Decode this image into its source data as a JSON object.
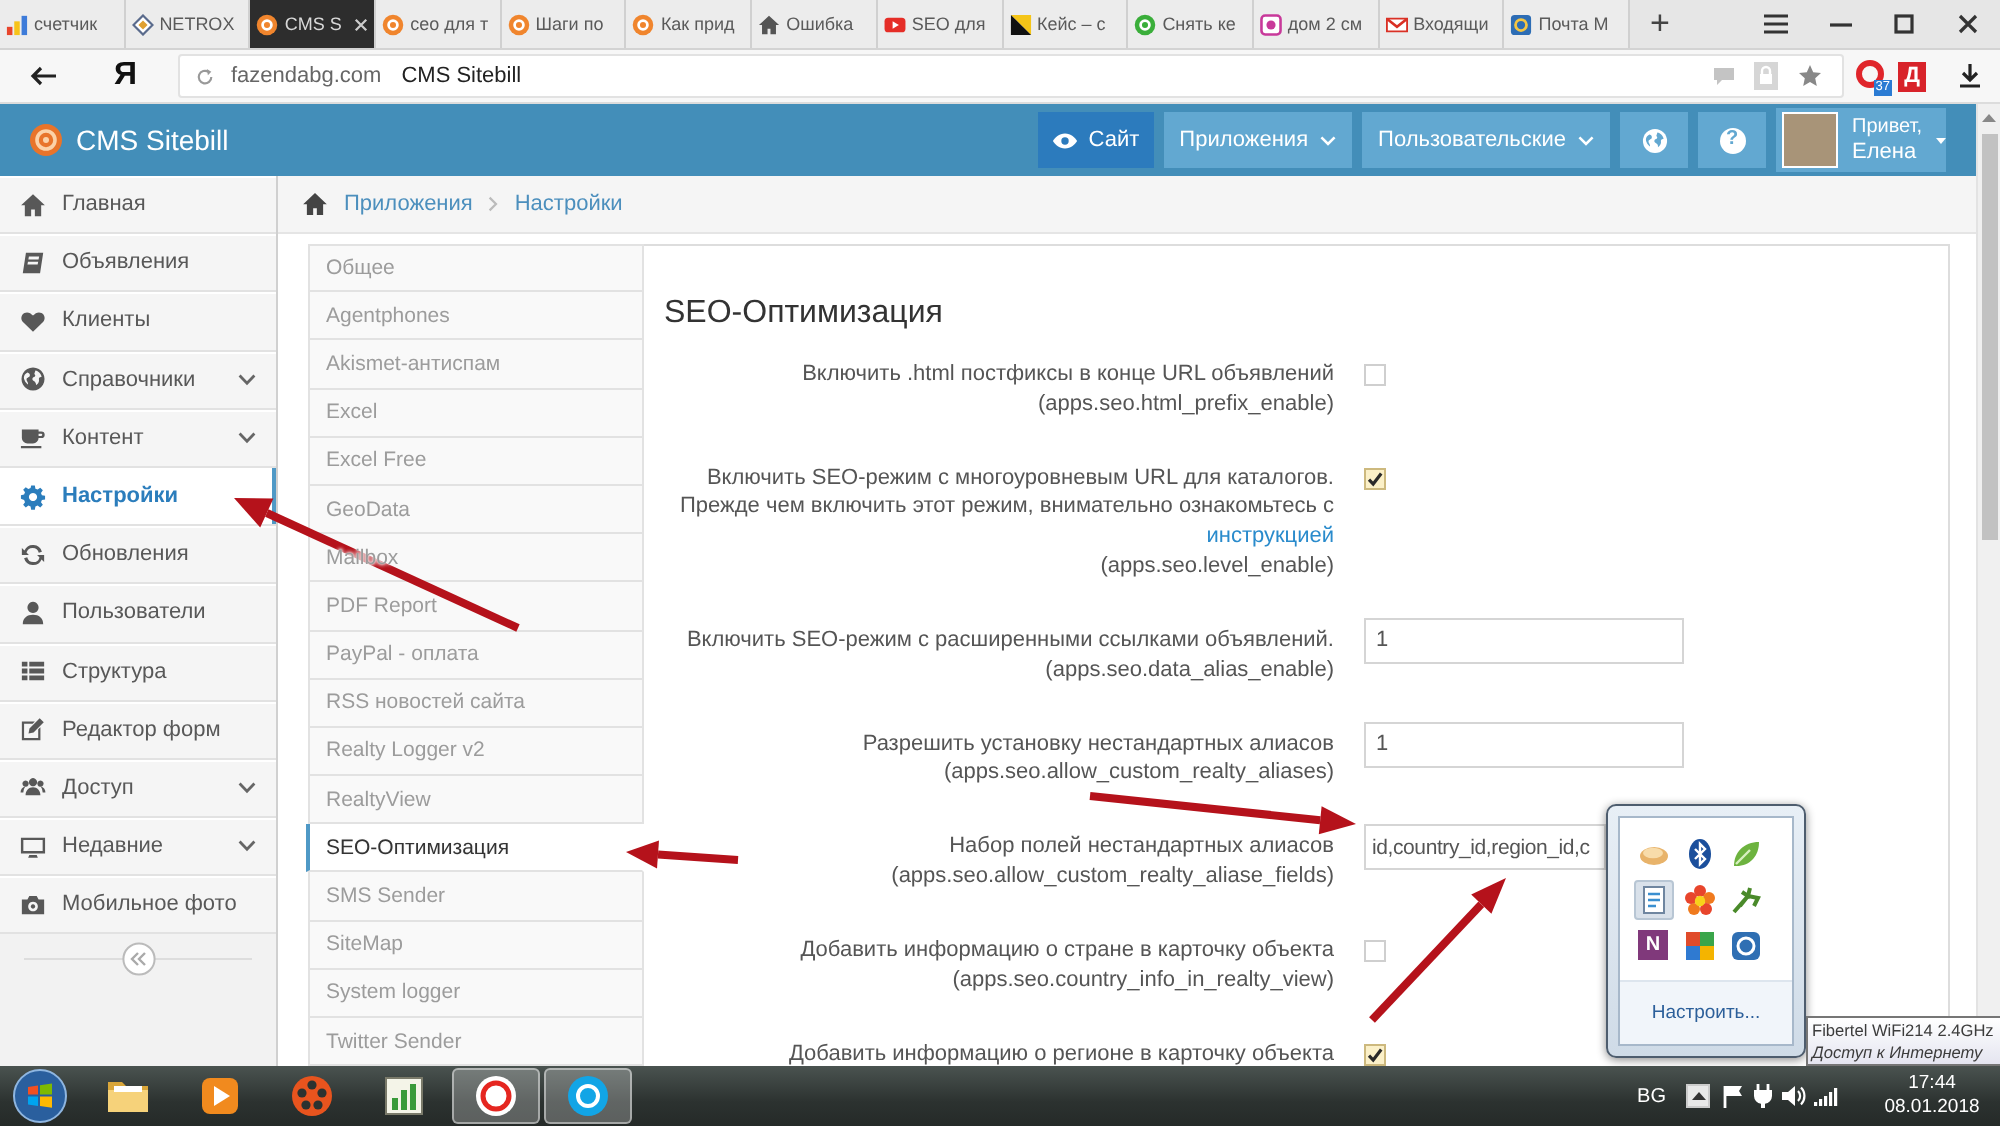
{
  "browser": {
    "tabs": [
      {
        "label": "счетчик",
        "selected": false
      },
      {
        "label": "NETROX",
        "selected": false
      },
      {
        "label": "CMS S",
        "selected": true
      },
      {
        "label": "сео для т",
        "selected": false
      },
      {
        "label": "Шаги по",
        "selected": false
      },
      {
        "label": "Как прид",
        "selected": false
      },
      {
        "label": "Ошибка",
        "selected": false
      },
      {
        "label": "SEO для",
        "selected": false
      },
      {
        "label": "Кейс – с",
        "selected": false
      },
      {
        "label": "Снять ке",
        "selected": false
      },
      {
        "label": "дом 2 см",
        "selected": false
      },
      {
        "label": "Входящи",
        "selected": false
      },
      {
        "label": "Почта М",
        "selected": false
      }
    ],
    "new_tab": "+",
    "home_letter": "Я",
    "address": {
      "domain": "fazendabg.com",
      "title": "CMS Sitebill"
    },
    "extensions": [
      {
        "kind": "badge",
        "badge": "37"
      },
      {
        "kind": "letter",
        "letter": "Д"
      }
    ]
  },
  "header": {
    "logo": "CMS Sitebill",
    "nav": [
      {
        "kind": "link",
        "label": "Сайт"
      },
      {
        "kind": "menu",
        "label": "Приложения"
      },
      {
        "kind": "menu",
        "label": "Пользовательские"
      }
    ],
    "help": "?",
    "user": {
      "greeting": "Привет,",
      "name": "Елена"
    }
  },
  "sidebar": {
    "items": [
      {
        "label": "Главная",
        "selected": false,
        "expandable": false
      },
      {
        "label": "Объявления",
        "selected": false,
        "expandable": false
      },
      {
        "label": "Клиенты",
        "selected": false,
        "expandable": false
      },
      {
        "label": "Справочники",
        "selected": false,
        "expandable": true
      },
      {
        "label": "Контент",
        "selected": false,
        "expandable": true
      },
      {
        "label": "Настройки",
        "selected": true,
        "expandable": false
      },
      {
        "label": "Обновления",
        "selected": false,
        "expandable": false
      },
      {
        "label": "Пользователи",
        "selected": false,
        "expandable": false
      },
      {
        "label": "Структура",
        "selected": false,
        "expandable": false
      },
      {
        "label": "Редактор форм",
        "selected": false,
        "expandable": false
      },
      {
        "label": "Доступ",
        "selected": false,
        "expandable": true
      },
      {
        "label": "Недавние",
        "selected": false,
        "expandable": true
      },
      {
        "label": "Мобильное фото",
        "selected": false,
        "expandable": false
      }
    ]
  },
  "breadcrumb": [
    "Приложения",
    "Настройки"
  ],
  "settings_menu": [
    {
      "label": "Общее",
      "selected": false
    },
    {
      "label": "Agentphones",
      "selected": false
    },
    {
      "label": "Akismet-антиспам",
      "selected": false
    },
    {
      "label": "Excel",
      "selected": false
    },
    {
      "label": "Excel Free",
      "selected": false
    },
    {
      "label": "GeoData",
      "selected": false
    },
    {
      "label": "Mailbox",
      "selected": false
    },
    {
      "label": "PDF Report",
      "selected": false
    },
    {
      "label": "PayPal - оплата",
      "selected": false
    },
    {
      "label": "RSS новостей сайта",
      "selected": false
    },
    {
      "label": "Realty Logger v2",
      "selected": false
    },
    {
      "label": "RealtyView",
      "selected": false
    },
    {
      "label": "SEO-Оптимизация",
      "selected": true
    },
    {
      "label": "SMS Sender",
      "selected": false
    },
    {
      "label": "SiteMap",
      "selected": false
    },
    {
      "label": "System logger",
      "selected": false
    },
    {
      "label": "Twitter Sender",
      "selected": false
    }
  ],
  "form": {
    "title": "SEO-Оптимизация",
    "fields": [
      {
        "kind": "checkbox",
        "label_lines": [
          "Включить .html постфиксы в конце URL объявлений"
        ],
        "key": "(apps.seo.html_prefix_enable)",
        "checked": false
      },
      {
        "kind": "checkbox",
        "label_lines": [
          "Включить SEO-режим с многоуровневым URL для каталогов.",
          "Прежде чем включить этот режим, внимательно ознакомьтесь с"
        ],
        "link": "инструкцией",
        "key": "(apps.seo.level_enable)",
        "checked": true
      },
      {
        "kind": "text",
        "label_lines": [
          "Включить SEO-режим с расширенными ссылками объявлений."
        ],
        "key": "(apps.seo.data_alias_enable)",
        "value": "1"
      },
      {
        "kind": "text",
        "label_lines": [
          "Разрешить установку нестандартных алиасов"
        ],
        "key": "(apps.seo.allow_custom_realty_aliases)",
        "value": "1"
      },
      {
        "kind": "text",
        "label_lines": [
          "Набор полей нестандартных алиасов"
        ],
        "key": "(apps.seo.allow_custom_realty_aliase_fields)",
        "value": "id,country_id,region_id,c"
      },
      {
        "kind": "checkbox",
        "label_lines": [
          "Добавить информацию о стране в карточку объекта"
        ],
        "key": "(apps.seo.country_info_in_realty_view)",
        "checked": false
      },
      {
        "kind": "checkbox",
        "label_lines": [
          "Добавить информацию о регионе в карточку объекта"
        ],
        "checked": true
      }
    ]
  },
  "tray_popup": {
    "icons": [
      {
        "selected": false
      },
      {
        "selected": false
      },
      {
        "selected": false
      },
      {
        "selected": true
      },
      {
        "selected": false
      },
      {
        "selected": false
      },
      {
        "selected": false,
        "letter": "N"
      },
      {
        "selected": false
      },
      {
        "selected": false
      }
    ],
    "customize": "Настроить..."
  },
  "tooltip": {
    "title": "Fibertel WiFi214 2.4GHz",
    "status": "Доступ к Интернету"
  },
  "taskbar": {
    "apps": [
      {
        "running": false
      },
      {
        "running": false
      },
      {
        "running": false
      },
      {
        "running": false
      },
      {
        "running": true
      },
      {
        "running": true
      }
    ],
    "language": "BG",
    "time": "17:44",
    "date": "08.01.2018"
  }
}
